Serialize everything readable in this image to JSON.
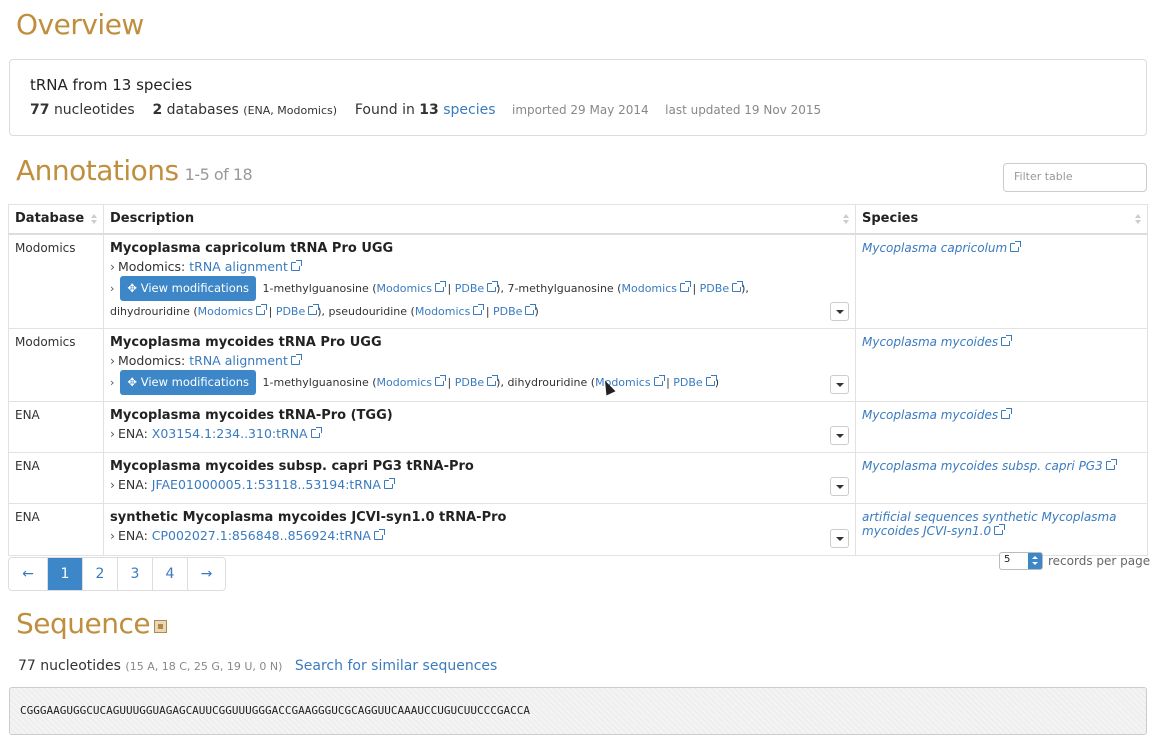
{
  "overview": {
    "title": "Overview",
    "summary": "tRNA from 13 species",
    "nucleotides_count": "77",
    "nucleotides_label": "nucleotides",
    "databases_count": "2",
    "databases_label": "databases",
    "databases_list": "(ENA, Modomics)",
    "found_in": "Found in",
    "species_count": "13",
    "species_link": "species",
    "imported": "imported 29 May 2014",
    "updated": "last updated 19 Nov 2015"
  },
  "annotations": {
    "title": "Annotations",
    "range": "1-5 of 18",
    "filter_placeholder": "Filter table",
    "columns": [
      "Database",
      "Description",
      "Species"
    ],
    "view_mods_label": "View modifications",
    "rows": [
      {
        "db": "Modomics",
        "title": "Mycoplasma capricolum tRNA Pro UGG",
        "line_prefix": "Modomics:",
        "line_link": "tRNA alignment",
        "mods": [
          {
            "name": "1-methylguanosine (",
            "sep": ""
          },
          {
            "name": "), 7-methylguanosine (",
            "sep": ""
          },
          {
            "name": "), dihydrouridine (",
            "sep": ""
          },
          {
            "name": "), pseudouridine (",
            "sep": ""
          }
        ],
        "species": "Mycoplasma capricolum"
      },
      {
        "db": "Modomics",
        "title": "Mycoplasma mycoides tRNA Pro UGG",
        "line_prefix": "Modomics:",
        "line_link": "tRNA alignment",
        "species": "Mycoplasma mycoides"
      },
      {
        "db": "ENA",
        "title": "Mycoplasma mycoides tRNA-Pro (TGG)",
        "line_prefix": "ENA:",
        "line_link": "X03154.1:234..310:tRNA",
        "species": "Mycoplasma mycoides"
      },
      {
        "db": "ENA",
        "title": "Mycoplasma mycoides subsp. capri PG3 tRNA-Pro",
        "line_prefix": "ENA:",
        "line_link": "JFAE01000005.1:53118..53194:tRNA",
        "species": "Mycoplasma mycoides subsp. capri PG3"
      },
      {
        "db": "ENA",
        "title": "synthetic Mycoplasma mycoides JCVI-syn1.0 tRNA-Pro",
        "line_prefix": "ENA:",
        "line_link": "CP002027.1:856848..856924:tRNA",
        "species": "artificial sequences synthetic Mycoplasma mycoides JCVI-syn1.0"
      }
    ],
    "mod_names": {
      "m1g": "1-methylguanosine",
      "m7g": "7-methylguanosine",
      "dhu": "dihydrouridine",
      "psi": "pseudouridine"
    },
    "mod_links": {
      "modomics": "Modomics",
      "pdbe": "PDBe"
    }
  },
  "pagination": {
    "prev": "←",
    "pages": [
      "1",
      "2",
      "3",
      "4"
    ],
    "active": "1",
    "next": "→",
    "records_value": "5",
    "records_label": "records per page"
  },
  "sequence": {
    "title": "Sequence",
    "length_label": "77 nucleotides",
    "composition": "(15 A, 18 C, 25 G, 19 U, 0 N)",
    "search_link": "Search for similar sequences",
    "sequence": "CGGGAAGUGGCUCAGUUUGGUAGAGCAUUCGGUUUGGGACCGAAGGGUCGCAGGUUCAAAUCCUGUCUUCCCGACCA"
  },
  "colors": {
    "heading": "#bf8f3f",
    "link": "#3a7bbf",
    "button": "#3d87c8"
  }
}
